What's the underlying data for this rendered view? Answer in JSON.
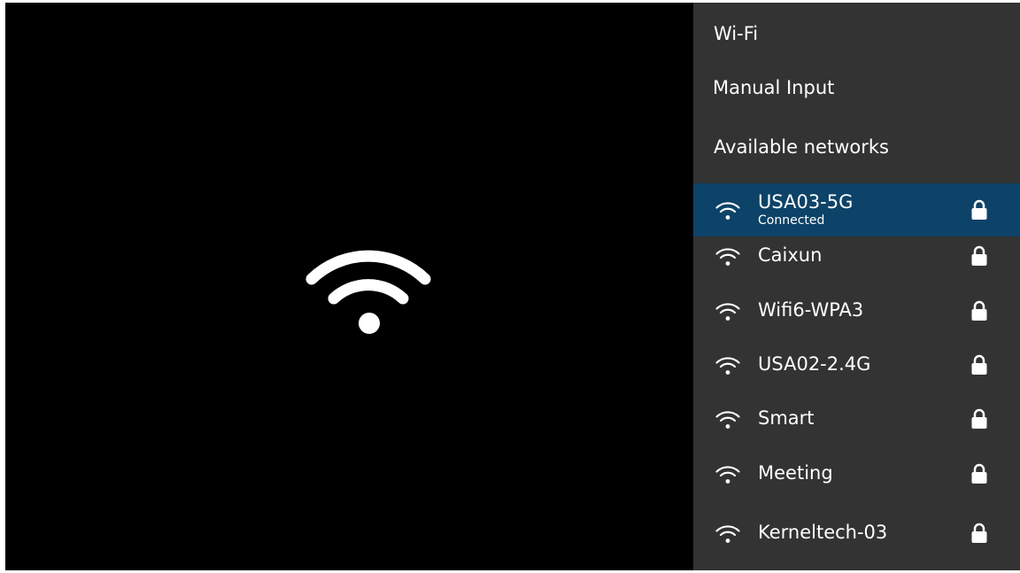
{
  "panel": {
    "title": "Wi-Fi",
    "manual_input_label": "Manual Input",
    "available_label": "Available networks"
  },
  "networks": [
    {
      "name": "USA03-5G",
      "status": "Connected",
      "secured": true,
      "selected": true
    },
    {
      "name": "Caixun",
      "status": "",
      "secured": true,
      "selected": false
    },
    {
      "name": "Wifi6-WPA3",
      "status": "",
      "secured": true,
      "selected": false
    },
    {
      "name": "USA02-2.4G",
      "status": "",
      "secured": true,
      "selected": false
    },
    {
      "name": "Smart",
      "status": "",
      "secured": true,
      "selected": false
    },
    {
      "name": "Meeting",
      "status": "",
      "secured": true,
      "selected": false
    },
    {
      "name": "Kerneltech-03",
      "status": "",
      "secured": true,
      "selected": false
    }
  ],
  "icons": {
    "hero": "wifi-icon",
    "network": "wifi-icon",
    "security": "lock-icon"
  },
  "colors": {
    "left_background": "#000000",
    "panel_background": "#333333",
    "selected_row": "#0d4368",
    "text": "#ffffff"
  }
}
